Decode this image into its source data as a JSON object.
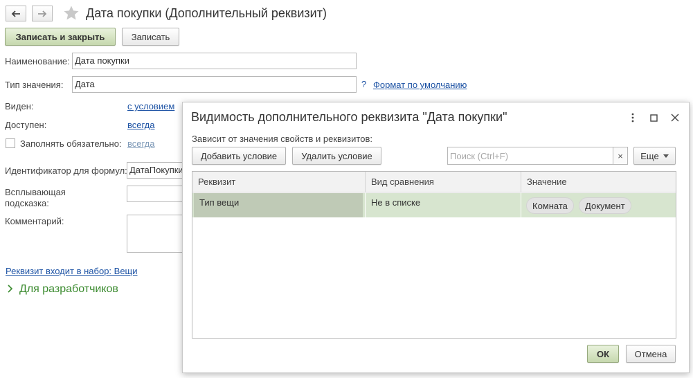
{
  "window": {
    "title": "Дата покупки (Дополнительный реквизит)",
    "save_close_label": "Записать и закрыть",
    "save_label": "Записать"
  },
  "form": {
    "name_label": "Наименование:",
    "name_value": "Дата покупки",
    "type_label": "Тип значения:",
    "type_value": "Дата",
    "help_mark": "?",
    "format_link": "Формат по умолчанию",
    "visible_label": "Виден:",
    "visible_link": "с условием",
    "available_label": "Доступен:",
    "available_link": "всегда",
    "required_label": "Заполнять обязательно:",
    "required_link": "всегда",
    "formula_id_label": "Идентификатор для формул:",
    "formula_id_value": "ДатаПокупки",
    "tooltip_label_line1": "Всплывающая",
    "tooltip_label_line2": "подсказка:",
    "comment_label": "Комментарий:",
    "set_link": "Реквизит входит в набор: Вещи",
    "dev_section": "Для разработчиков"
  },
  "dialog": {
    "title": "Видимость дополнительного реквизита \"Дата покупки\"",
    "depends_label": "Зависит от значения свойств и реквизитов:",
    "add_condition": "Добавить условие",
    "remove_condition": "Удалить условие",
    "search_placeholder": "Поиск (Ctrl+F)",
    "clear_search": "×",
    "more_label": "Еще",
    "ok_label": "ОК",
    "cancel_label": "Отмена",
    "columns": [
      "Реквизит",
      "Вид сравнения",
      "Значение"
    ],
    "rows": [
      {
        "attribute": "Тип вещи",
        "comparison": "Не в списке",
        "values": [
          "Комната",
          "Документ"
        ]
      }
    ]
  },
  "colors": {
    "accent_green": "#3a8a2e",
    "link_blue": "#1c52a4",
    "selected_row": "#d7e5cf",
    "selected_cell": "#bfcab6"
  }
}
